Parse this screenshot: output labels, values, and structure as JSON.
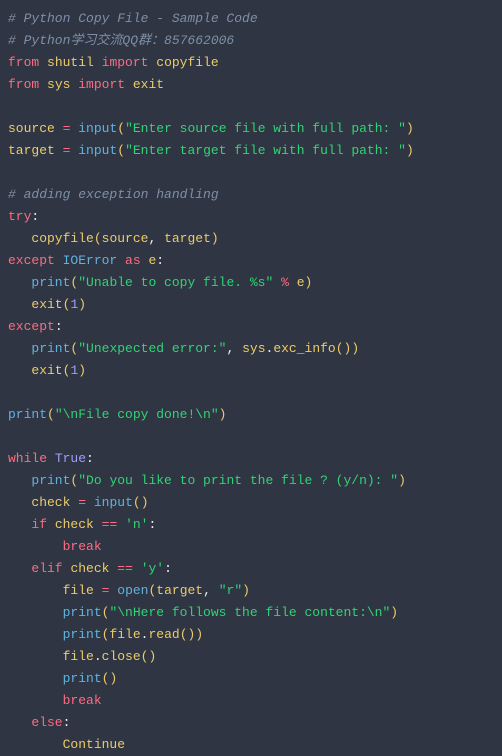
{
  "code": {
    "line1_comment": "# Python Copy File - Sample Code",
    "line2_comment": "# Python学习交流QQ群：857662006",
    "from1": "from",
    "shutil": "shutil",
    "import1": "import",
    "copyfile": "copyfile",
    "from2": "from",
    "sys": "sys",
    "import2": "import",
    "exit": "exit",
    "source": "source",
    "eq": "=",
    "input": "input",
    "str_src": "\"Enter source file with full path: \"",
    "target": "target",
    "str_tgt": "\"Enter target file with full path: \"",
    "line_excomment": "# adding exception handling",
    "try": "try",
    "copyfile2": "copyfile",
    "except": "except",
    "ioerror": "IOError",
    "as": "as",
    "e": "e",
    "print": "print",
    "str_unable": "\"Unable to copy file. %s\"",
    "pct": "%",
    "exit2": "exit",
    "one": "1",
    "str_unexp": "\"Unexpected error:\"",
    "comma": ",",
    "sys2": "sys",
    "exc_info": "exc_info",
    "str_done": "\"\\nFile copy done!\\n\"",
    "while": "while",
    "true": "True",
    "str_like": "\"Do you like to print the file ? (y/n): \"",
    "check": "check",
    "if": "if",
    "eqeq": "==",
    "str_n": "'n'",
    "break": "break",
    "elif": "elif",
    "str_y": "'y'",
    "file": "file",
    "open": "open",
    "str_r": "\"r\"",
    "str_here": "\"\\nHere follows the file content:\\n\"",
    "read": "read",
    "close": "close",
    "else": "else",
    "continue": "Continue"
  }
}
